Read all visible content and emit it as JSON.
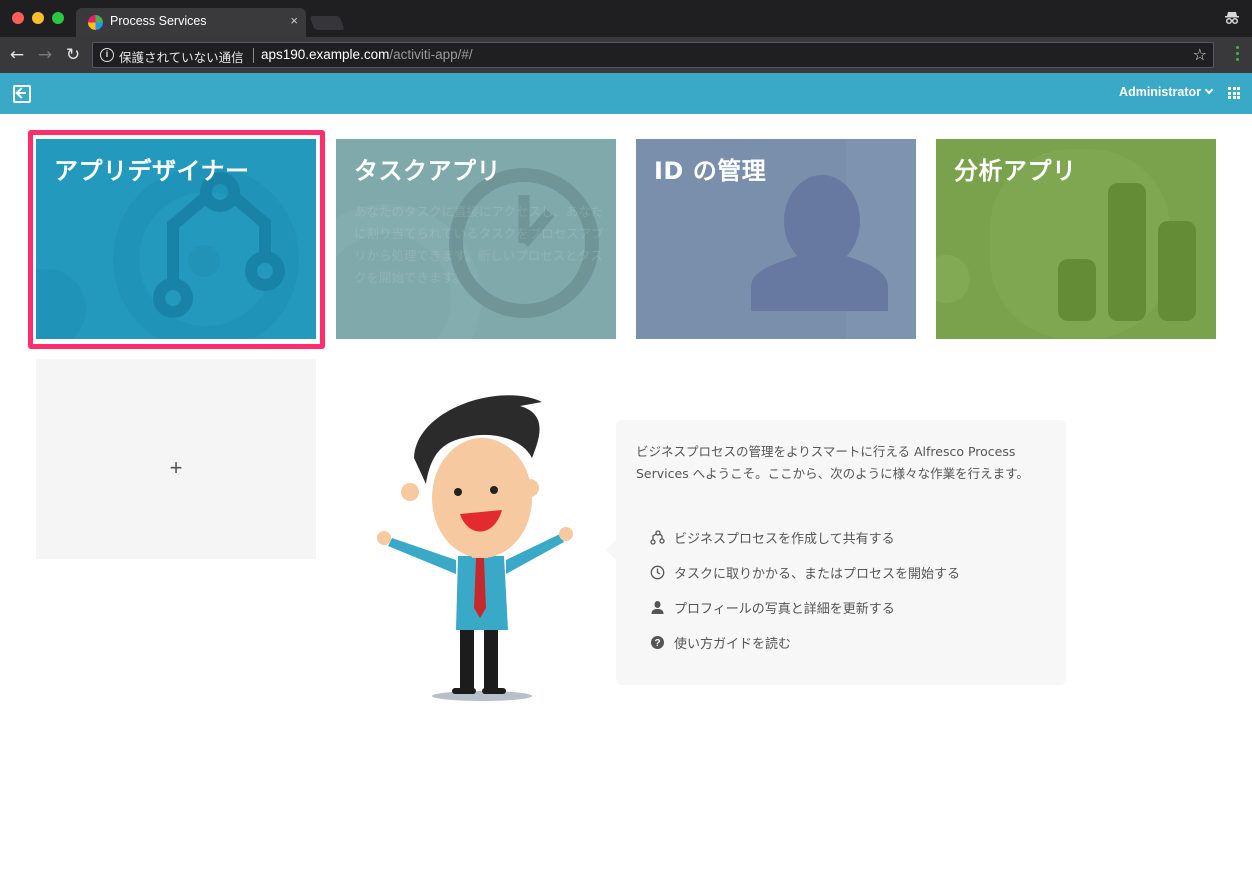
{
  "browser": {
    "tab_title": "Process Services",
    "tab_close": "×",
    "security_label": "保護されていない通信",
    "url_host": "aps190.example.com",
    "url_path": "/activiti-app/#/",
    "nav_back": "←",
    "nav_forward": "→",
    "nav_reload": "↻",
    "bookmark_star": "☆",
    "info_glyph": "i"
  },
  "header": {
    "user_name": "Administrator"
  },
  "tiles": [
    {
      "title": "アプリデザイナー",
      "color": "#2399bd"
    },
    {
      "title": "タスクアプリ",
      "description": "あなたのタスクに直接にアクセスし、あなたに割り当てられているタスクをプロセスアプリから処理できます。新しいプロセスとタスクを開始できます。",
      "color": "#7fa9ab"
    },
    {
      "title": "ID の管理",
      "color": "#7a8fac"
    },
    {
      "title": "分析アプリ",
      "color": "#7aa24c"
    }
  ],
  "add_tile": {
    "label": "+"
  },
  "highlight_color": "#ff2d6c",
  "welcome": {
    "intro": "ビジネスプロセスの管理をよりスマートに行える Alfresco Process Services へようこそ。ここから、次のように様々な作業を行えます。",
    "features": [
      {
        "icon": "process-icon",
        "label": "ビジネスプロセスを作成して共有する"
      },
      {
        "icon": "clock-icon",
        "label": "タスクに取りかかる、またはプロセスを開始する"
      },
      {
        "icon": "user-icon",
        "label": "プロフィールの写真と詳細を更新する"
      },
      {
        "icon": "help-icon",
        "label": "使い方ガイドを読む"
      }
    ]
  }
}
